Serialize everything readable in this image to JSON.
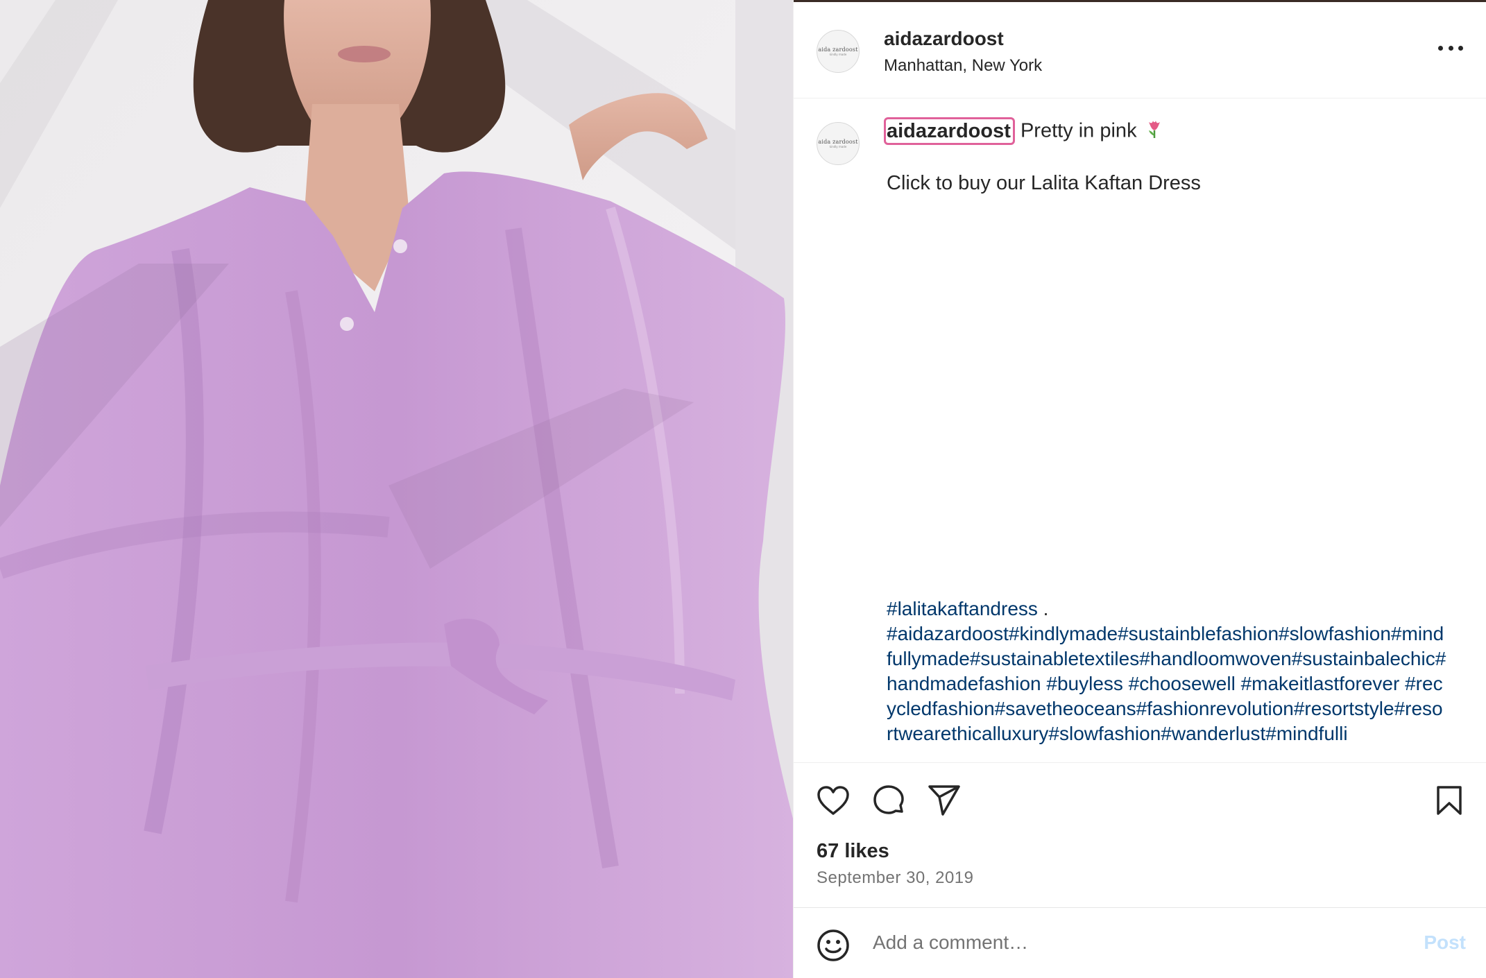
{
  "post": {
    "username": "aidazardoost",
    "location": "Manhattan, New York",
    "avatar_logo": {
      "line1": "aida zardoost",
      "line2": "kindly made"
    }
  },
  "caption": {
    "username": "aidazardoost",
    "text": "Pretty in pink",
    "emoji_icon": "tulip-icon",
    "line2": "Click to buy our Lalita Kaftan Dress",
    "hashtags_first": "#lalitakaftandress",
    "hashtags_sep": " .",
    "hashtags_rest": "#aidazardoost#kindlymade#sustainblefashion#slowfashion#mindfullymade#sustainabletextiles#handloomwoven#sustainbalechic#handmadefashion #buyless #choosewell #makeitlastforever #recycledfashion#savetheoceans#fashionrevolution#resortstyle#resortwearethicalluxury#slowfashion#wanderlust#mindfulli"
  },
  "actions": {
    "icons": [
      "heart-icon",
      "comment-icon",
      "share-icon",
      "bookmark-icon"
    ]
  },
  "stats": {
    "likes": "67 likes",
    "date": "September 30, 2019"
  },
  "comment": {
    "placeholder": "Add a comment…",
    "post_label": "Post",
    "emoji_icon": "smiley-icon"
  },
  "colors": {
    "hashtag": "#00376b",
    "highlight_border": "#e0619a",
    "post_disabled": "#c3e1fc",
    "dress": "#c79ad3"
  }
}
